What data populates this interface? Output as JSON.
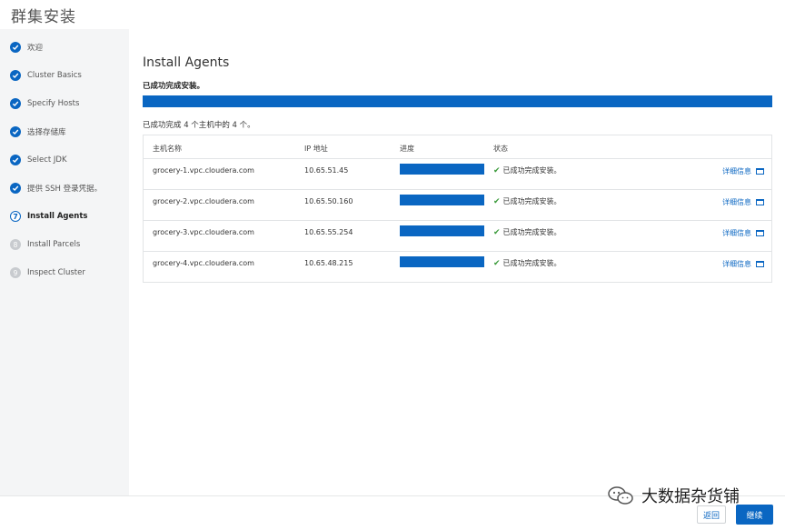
{
  "header": {
    "title": "群集安装"
  },
  "sidebar": {
    "steps": [
      {
        "label": "欢迎",
        "state": "done",
        "marker": ""
      },
      {
        "label": "Cluster Basics",
        "state": "done",
        "marker": ""
      },
      {
        "label": "Specify Hosts",
        "state": "done",
        "marker": ""
      },
      {
        "label": "选择存储库",
        "state": "done",
        "marker": ""
      },
      {
        "label": "Select JDK",
        "state": "done",
        "marker": ""
      },
      {
        "label": "提供 SSH 登录凭据。",
        "state": "done",
        "marker": ""
      },
      {
        "label": "Install Agents",
        "state": "current",
        "marker": "7"
      },
      {
        "label": "Install Parcels",
        "state": "todo",
        "marker": "8"
      },
      {
        "label": "Inspect Cluster",
        "state": "todo",
        "marker": "9"
      }
    ]
  },
  "main": {
    "title": "Install Agents",
    "status": "已成功完成安装。",
    "overall_progress": 1.0,
    "summary": "已成功完成 4 个主机中的 4 个。",
    "columns": {
      "host": "主机名称",
      "ip": "IP 地址",
      "progress": "进度",
      "status": "状态"
    },
    "rows": [
      {
        "host": "grocery-1.vpc.cloudera.com",
        "ip": "10.65.51.45",
        "progress": 1.0,
        "status": "已成功完成安装。",
        "details": "详细信息"
      },
      {
        "host": "grocery-2.vpc.cloudera.com",
        "ip": "10.65.50.160",
        "progress": 1.0,
        "status": "已成功完成安装。",
        "details": "详细信息"
      },
      {
        "host": "grocery-3.vpc.cloudera.com",
        "ip": "10.65.55.254",
        "progress": 1.0,
        "status": "已成功完成安装。",
        "details": "详细信息"
      },
      {
        "host": "grocery-4.vpc.cloudera.com",
        "ip": "10.65.48.215",
        "progress": 1.0,
        "status": "已成功完成安装。",
        "details": "详细信息"
      }
    ]
  },
  "footer": {
    "back_label": "返回",
    "next_label": "继续"
  },
  "watermark": {
    "text": "大数据杂货铺",
    "icon": "wechat-logo-icon"
  },
  "colors": {
    "accent": "#0a66c2",
    "success": "#3a9a3a",
    "sidebar_bg": "#f4f5f6"
  }
}
